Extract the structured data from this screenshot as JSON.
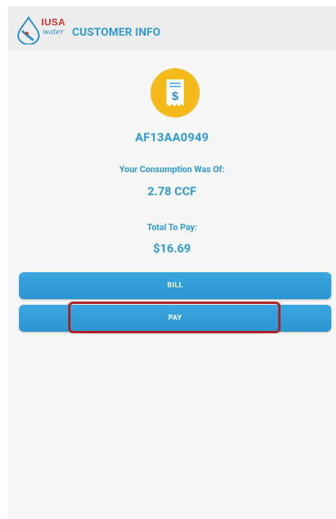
{
  "header": {
    "brand": "IUSA",
    "brand_sub": "water",
    "title": "CUSTOMER INFO"
  },
  "icons": {
    "logo": "iusa-water-drop-icon",
    "bill": "receipt-dollar-icon"
  },
  "customer": {
    "account": "AF13AA0949",
    "consumption_label": "Your Consumption Was Of:",
    "consumption_value": "2.78 CCF",
    "total_label": "Total To Pay:",
    "total_value": "$16.69"
  },
  "actions": {
    "bill_label": "BILL",
    "pay_label": "PAY"
  },
  "colors": {
    "accent": "#2e9bd6",
    "button": "#339fdb",
    "icon_bg": "#f6b91a",
    "brand_red": "#d0312d",
    "highlight": "#b01f24"
  }
}
